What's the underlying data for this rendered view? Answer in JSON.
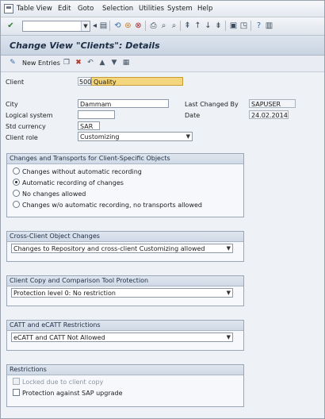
{
  "menubar": {
    "items": [
      "Table View",
      "Edit",
      "Goto",
      "Selection",
      "Utilities",
      "System",
      "Help"
    ]
  },
  "title": "Change View \"Clients\": Details",
  "app_toolbar": {
    "new_entries": "New Entries"
  },
  "form": {
    "client_label": "Client",
    "client_number": "500",
    "client_name": "Quality",
    "city_label": "City",
    "city": "Dammam",
    "logical_system_label": "Logical system",
    "logical_system": "",
    "currency_label": "Std currency",
    "currency": "SAR",
    "role_label": "Client role",
    "role": "Customizing",
    "last_changed_by_label": "Last Changed By",
    "last_changed_by": "SAPUSER",
    "date_label": "Date",
    "date": "24.02.2014"
  },
  "changes_group": {
    "title": "Changes and Transports for Client-Specific Objects",
    "options": [
      "Changes without automatic recording",
      "Automatic recording of changes",
      "No changes allowed",
      "Changes w/o automatic recording, no transports allowed"
    ],
    "selected_index": 1
  },
  "cross_client_group": {
    "title": "Cross-Client Object Changes",
    "value": "Changes to Repository and cross-client Customizing allowed"
  },
  "copy_group": {
    "title": "Client Copy and Comparison Tool Protection",
    "value": "Protection level 0: No restriction"
  },
  "catt_group": {
    "title": "CATT and eCATT Restrictions",
    "value": "eCATT and CATT Not Allowed"
  },
  "restrictions_group": {
    "title": "Restrictions",
    "locked_label": "Locked due to client copy",
    "protection_label": "Protection against SAP upgrade"
  }
}
